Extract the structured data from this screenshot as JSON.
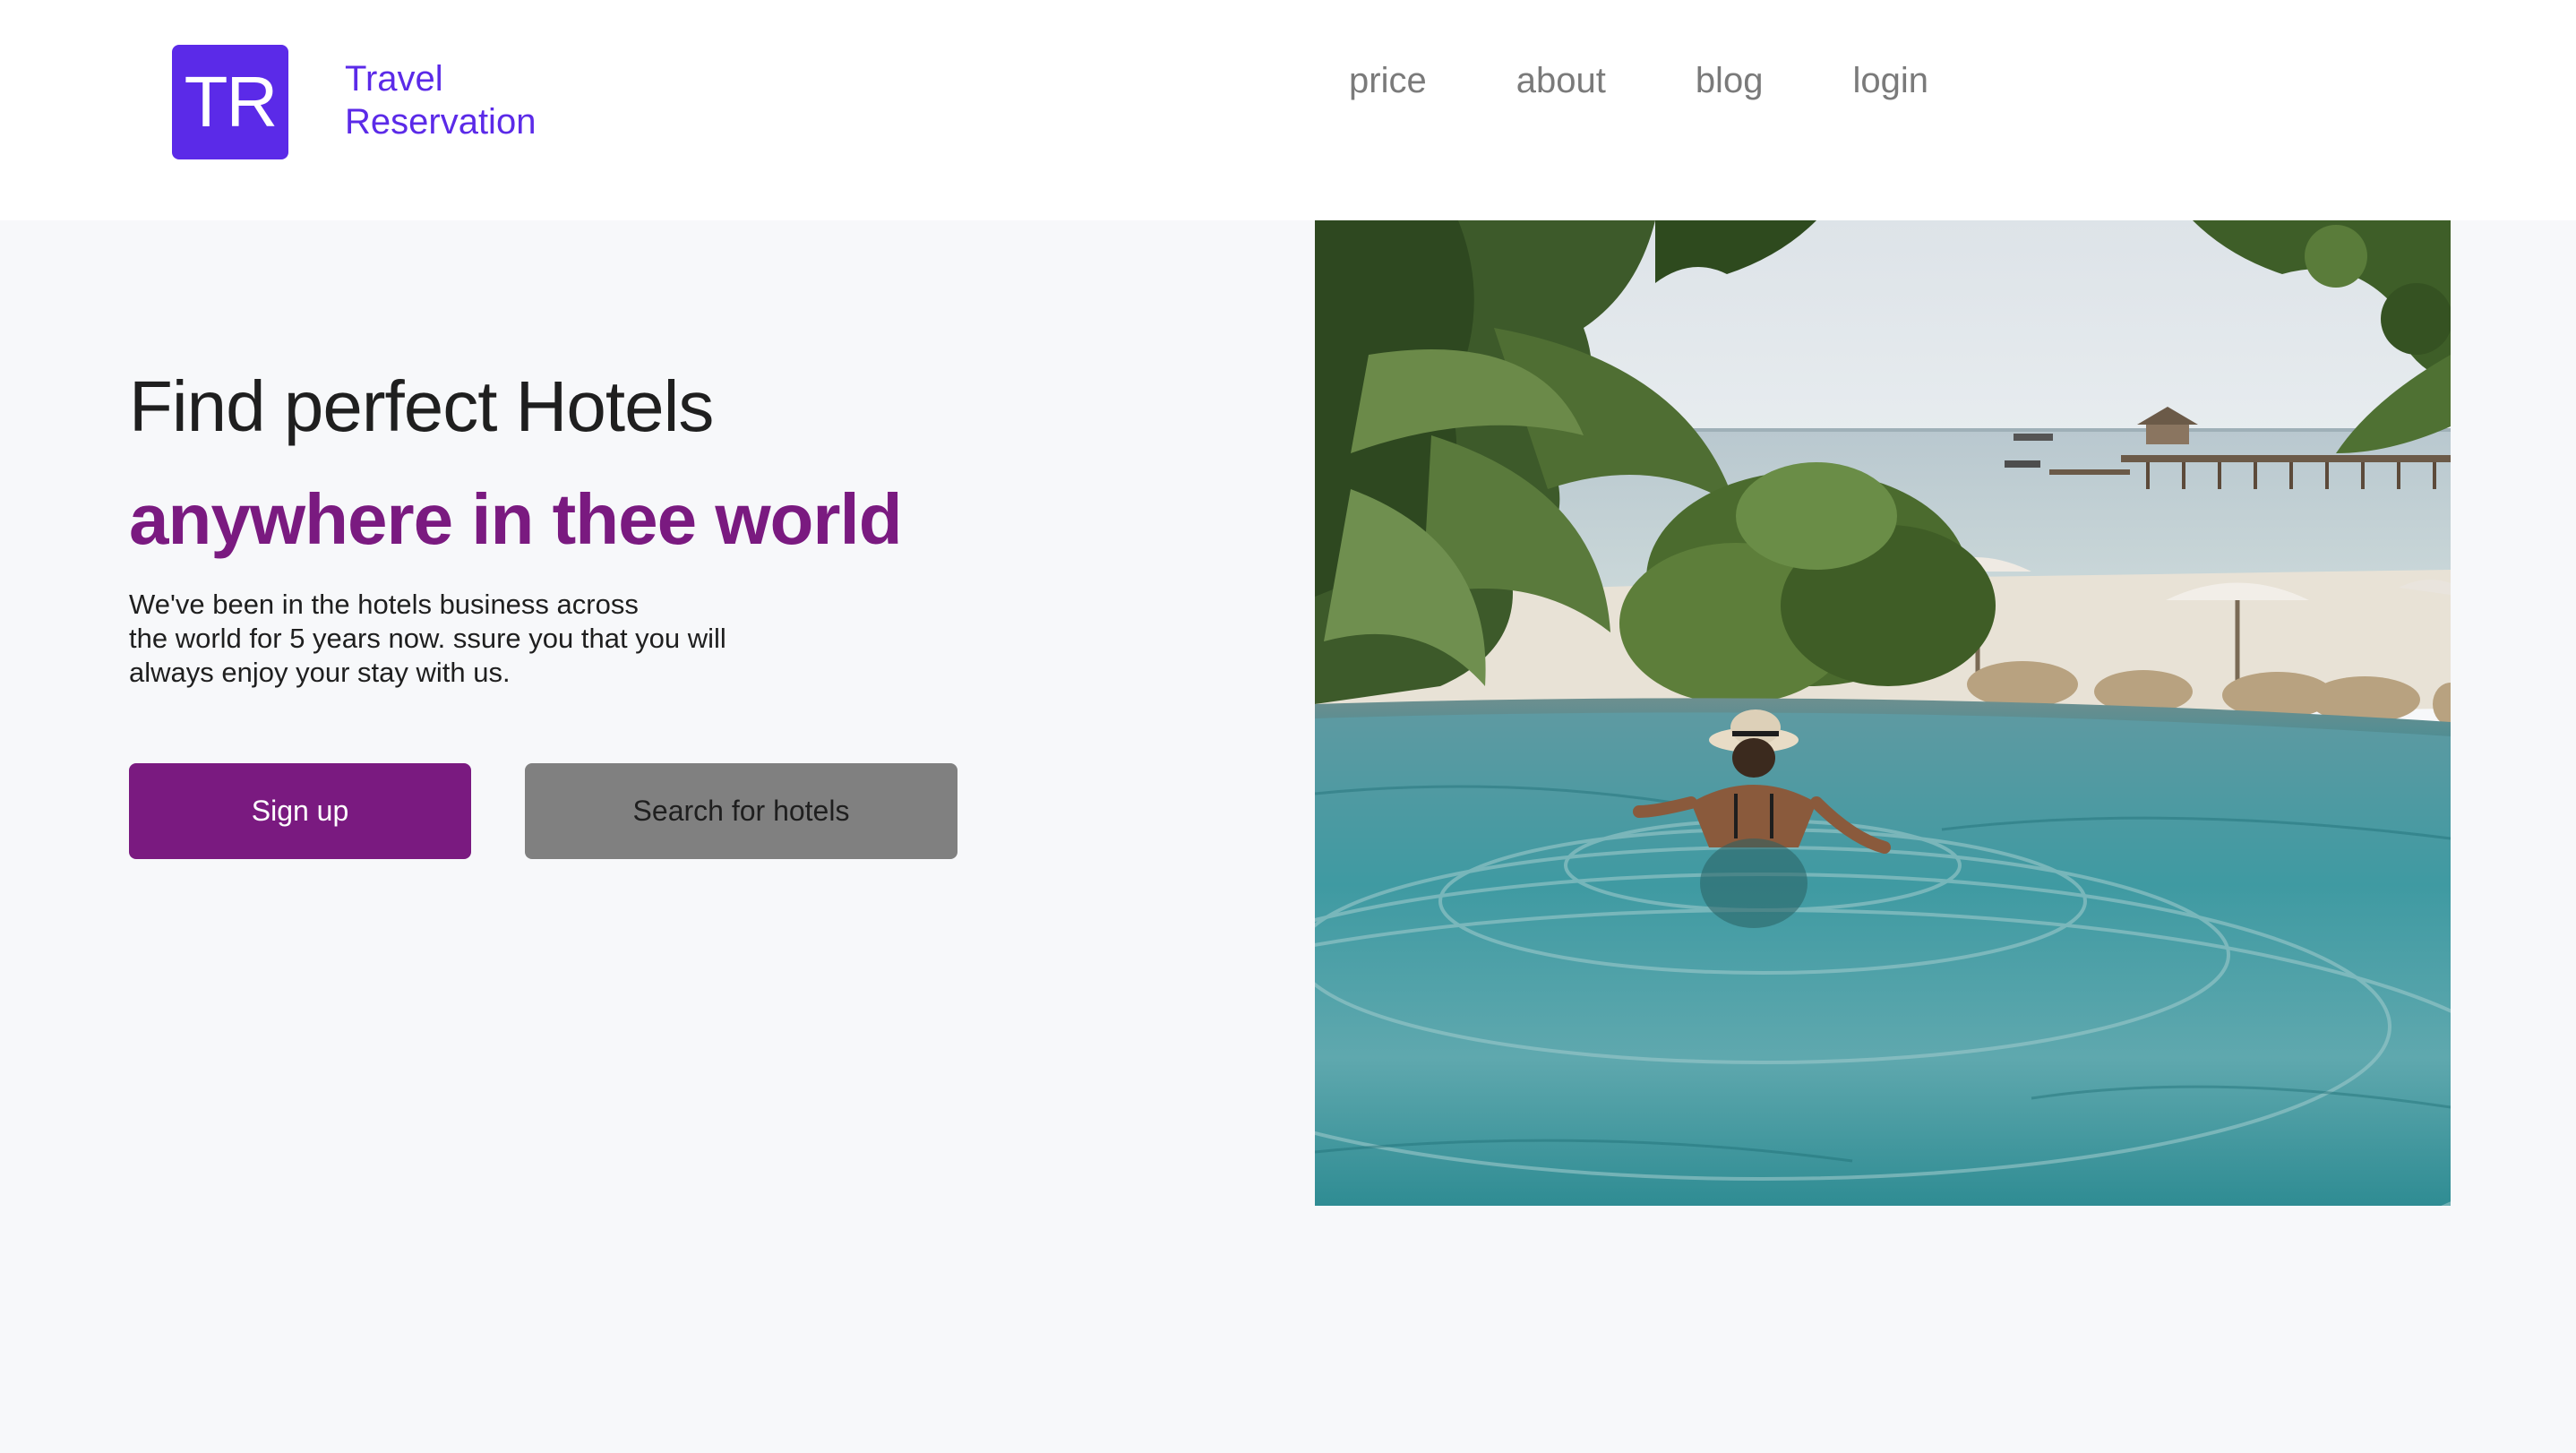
{
  "header": {
    "logo_text": "TR",
    "brand_line1": "Travel",
    "brand_line2": "Reservation",
    "brand_color": "#5b2ae8"
  },
  "nav": {
    "items": [
      {
        "label": "price"
      },
      {
        "label": "about"
      },
      {
        "label": "blog"
      },
      {
        "label": "login"
      }
    ]
  },
  "hero": {
    "title": "Find perfect Hotels",
    "subtitle": "anywhere in thee world",
    "description_lines": [
      "We've been in the hotels business across",
      "the world for 5 years now. ssure you that you will",
      "always enjoy your stay with us."
    ],
    "accent_color": "#7a1a80"
  },
  "buttons": {
    "signup_label": "Sign up",
    "search_label": "Search for hotels"
  },
  "image": {
    "subject": "woman-in-infinity-pool-photo"
  }
}
